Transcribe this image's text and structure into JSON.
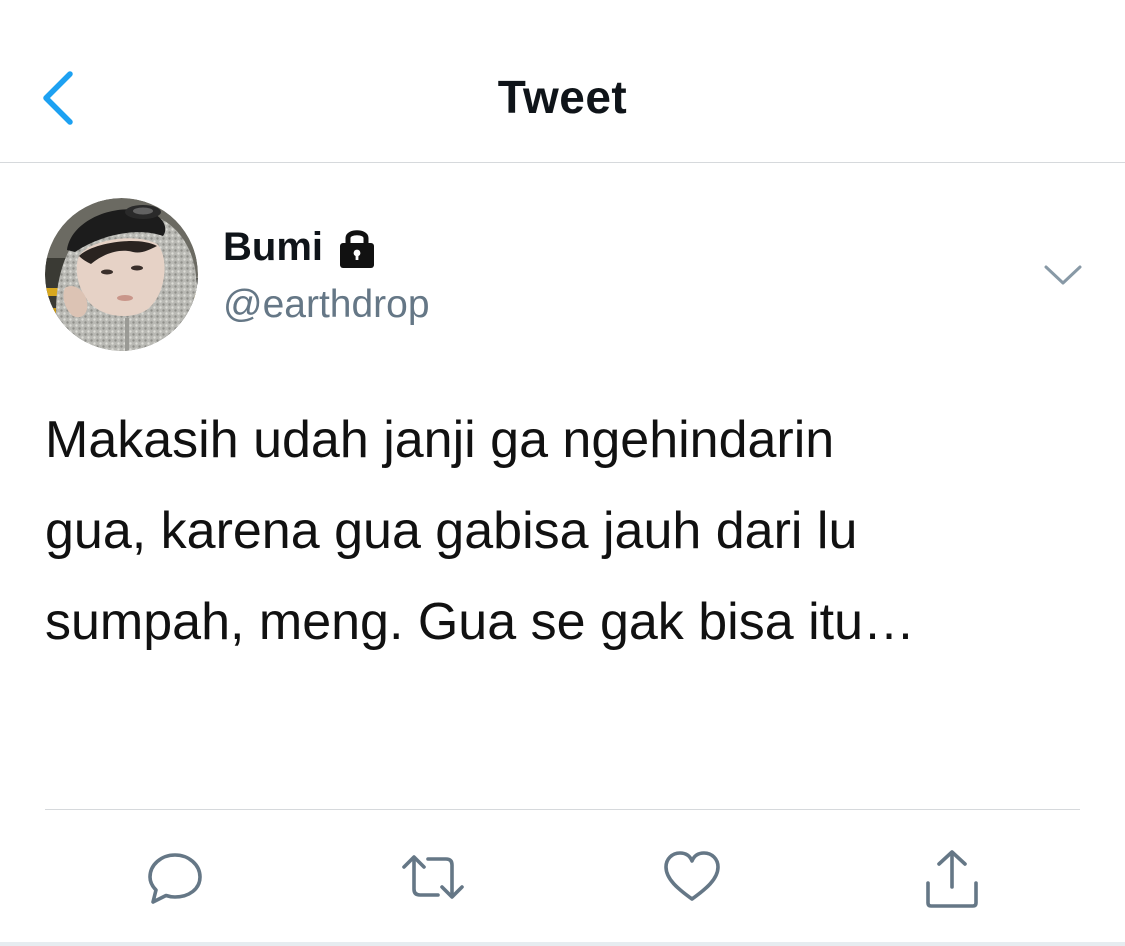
{
  "header": {
    "title": "Tweet",
    "back_icon": "chevron-left-icon"
  },
  "author": {
    "display_name": "Bumi",
    "handle": "@earthdrop",
    "protected_icon": "lock-icon",
    "more_icon": "chevron-down-icon"
  },
  "tweet": {
    "text": "Makasih udah janji ga ngehindarin\ngua, karena gua gabisa jauh dari lu\nsumpah, meng. Gua se gak bisa itu…"
  },
  "actions": {
    "reply_icon": "reply-icon",
    "retweet_icon": "retweet-icon",
    "like_icon": "heart-icon",
    "share_icon": "share-icon"
  },
  "colors": {
    "accent": "#1da1f2",
    "icon_gray": "#657786",
    "divider": "#d6d9dc",
    "text": "#0f1419"
  }
}
